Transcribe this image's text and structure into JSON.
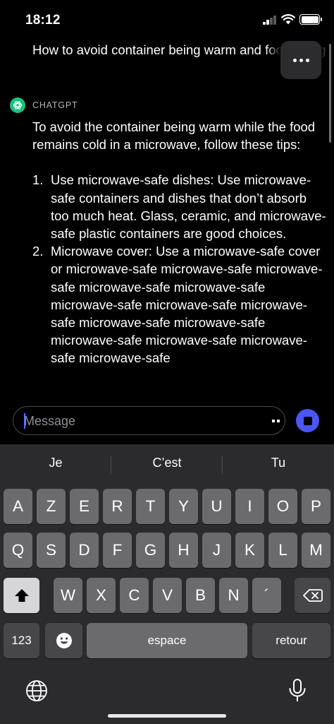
{
  "status": {
    "time": "18:12"
  },
  "thread": {
    "user_message": "How to avoid container being warm and food being cold in a microwave",
    "assistant_name": "CHATGPT",
    "assistant_intro": "To avoid the container being warm while the food remains cold in a microwave, follow these tips:",
    "tips": [
      {
        "num": "1.",
        "text": "Use microwave-safe dishes: Use microwave-safe containers and dishes that don’t absorb too much heat. Glass, ceramic, and microwave-safe plastic containers are good choices."
      },
      {
        "num": "2.",
        "text": "Microwave cover: Use a microwave-safe cover or microwave-safe microwave-safe microwave-safe microwave-safe microwave-safe microwave-safe microwave-safe microwave-safe microwave-safe microwave-safe microwave-safe microwave-safe microwave-safe microwave-safe"
      }
    ]
  },
  "composer": {
    "placeholder": "Message"
  },
  "keyboard": {
    "suggestions": [
      "Je",
      "C’est",
      "Tu"
    ],
    "row1": [
      "A",
      "Z",
      "E",
      "R",
      "T",
      "Y",
      "U",
      "I",
      "O",
      "P"
    ],
    "row2": [
      "Q",
      "S",
      "D",
      "F",
      "G",
      "H",
      "J",
      "K",
      "L",
      "M"
    ],
    "row3": [
      "W",
      "X",
      "C",
      "V",
      "B",
      "N",
      "´"
    ],
    "numbers_label": "123",
    "space_label": "espace",
    "return_label": "retour"
  },
  "icons": {
    "more": "more-horizontal-icon",
    "assistant": "openai-logo-icon",
    "stop": "stop-icon",
    "shift": "shift-icon",
    "delete": "delete-backward-icon",
    "emoji": "emoji-icon",
    "globe": "globe-icon",
    "mic": "microphone-icon"
  },
  "colors": {
    "background": "#000000",
    "accent": "#4b56f5",
    "assistant_avatar": "#19c37d",
    "keyboard_bg": "#2b2b2d",
    "key": "#6b6b6e"
  }
}
